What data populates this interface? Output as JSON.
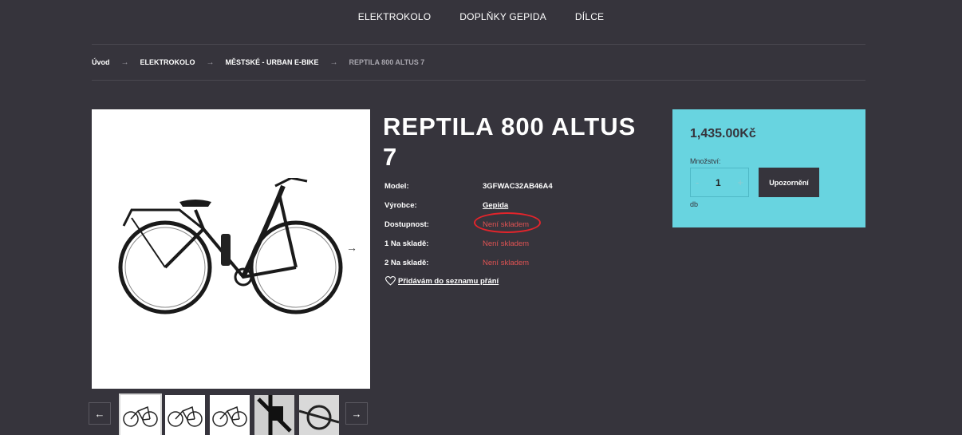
{
  "nav": {
    "items": [
      "ELEKTROKOLO",
      "DOPLŇKY GEPIDA",
      "DÍLCE"
    ]
  },
  "breadcrumb": {
    "items": [
      "Úvod",
      "ELEKTROKOLO",
      "MĚSTSKÉ - URBAN E-BIKE"
    ],
    "current": "REPTILA 800 ALTUS 7",
    "separator": "→"
  },
  "product": {
    "title": "REPTILA 800 ALTUS 7",
    "specs": [
      {
        "label": "Model:",
        "value": "3GFWAC32AB46A4"
      },
      {
        "label": "Výrobce:",
        "value": "Gepida"
      },
      {
        "label": "Dostupnost:",
        "value": "Není skladem"
      },
      {
        "label": "1 Na skladě:",
        "value": "Není skladem"
      },
      {
        "label": "2 Na skladě:",
        "value": "Není skladem"
      }
    ],
    "wishlist_label": "Přidávám do seznamu přání"
  },
  "gallery": {
    "next_arrow": "→",
    "prev_arrow": "←",
    "thumbs_count": 5
  },
  "buybox": {
    "price": "1,435.00Kč",
    "qty_label": "Množství:",
    "qty_value": "1",
    "minus": "-",
    "plus": "+",
    "notify_label": "Upozornění",
    "unit": "db"
  },
  "colors": {
    "background": "#36343c",
    "accent": "#68d4e0",
    "out_of_stock": "#e05353",
    "highlight_circle": "#e3242b"
  }
}
